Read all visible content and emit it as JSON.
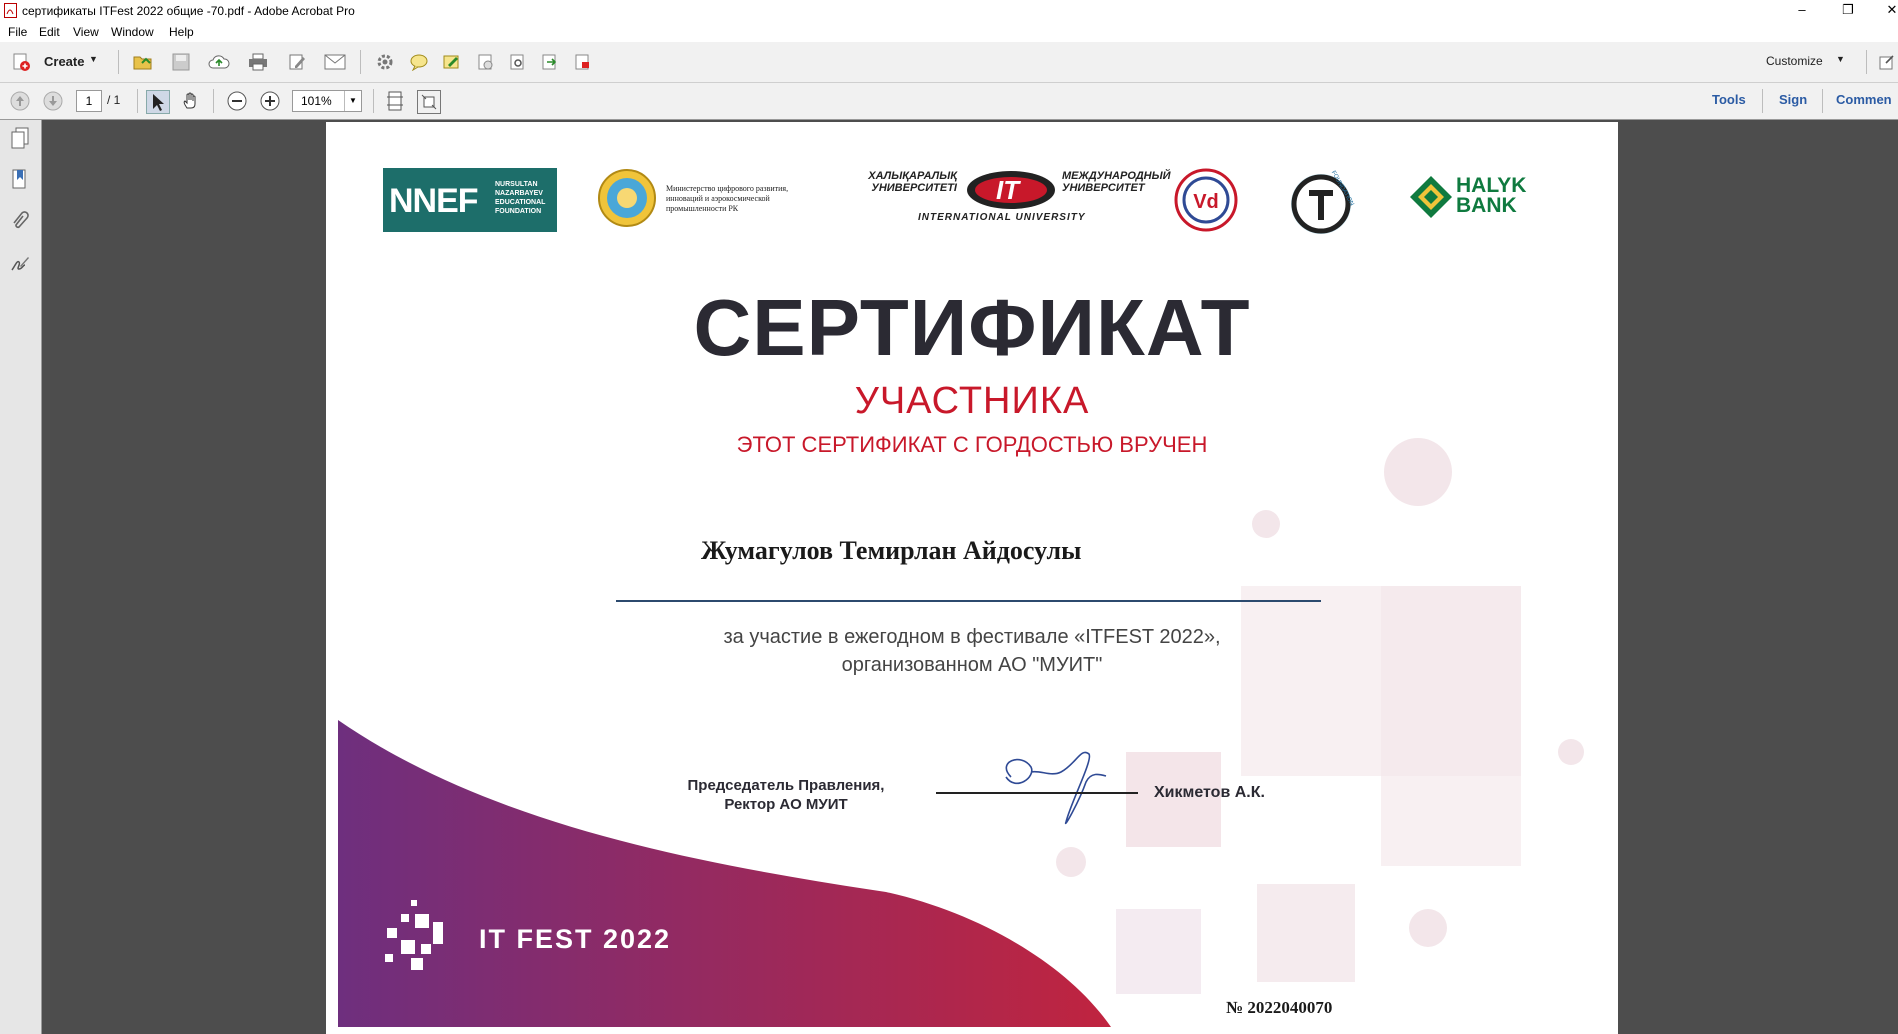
{
  "window": {
    "title": "сертификаты ITFest 2022 общие -70.pdf - Adobe Acrobat Pro"
  },
  "menu": [
    "File",
    "Edit",
    "View",
    "Window",
    "Help"
  ],
  "toolbar": {
    "create_label": "Create",
    "customize_label": "Customize"
  },
  "nav": {
    "page_current": "1",
    "page_total": "/ 1",
    "zoom": "101%",
    "tools_label": "Tools",
    "sign_label": "Sign",
    "comment_label": "Commen"
  },
  "certificate": {
    "logos": {
      "nnef_big": "NNEF",
      "nnef_small": "NURSULTAN NAZARBAYEV EDUCATIONAL FOUNDATION",
      "ministry": "Министерство цифрового развития, инноваций и аэрокосмической промышленности РК",
      "univ_left": "ХАЛЫҚАРАЛЫҚ УНИВЕРСИТЕТІ",
      "univ_right": "МЕЖДУНАРОДНЫЙ УНИВЕРСИТЕТ",
      "univ_center": "IT",
      "univ_bottom": "INTERNATIONAL UNIVERSITY",
      "fund": "FOUNDATION",
      "halyk": "HALYK BANK"
    },
    "title": "СЕРТИФИКАТ",
    "subtitle": "УЧАСТНИКА",
    "tagline": "ЭТОТ СЕРТИФИКАТ С ГОРДОСТЬЮ ВРУЧЕН",
    "recipient": "Жумагулов Темирлан Айдосулы",
    "reason_line1": "за участие в ежегодном в фестивале «ITFEST 2022»,",
    "reason_line2": "организованном АО \"МУИТ\"",
    "signer_title_line1": "Председатель Правления,",
    "signer_title_line2": "Ректор АО МУИТ",
    "signer_name": "Хикметов А.К.",
    "event_logo": "IT FEST 2022",
    "number": "№ 2022040070"
  },
  "colors": {
    "accent_red": "#c8182a",
    "title_dark": "#2b2a33",
    "nnef_teal": "#1d6e6a",
    "halyk_green": "#0f7a3f"
  }
}
